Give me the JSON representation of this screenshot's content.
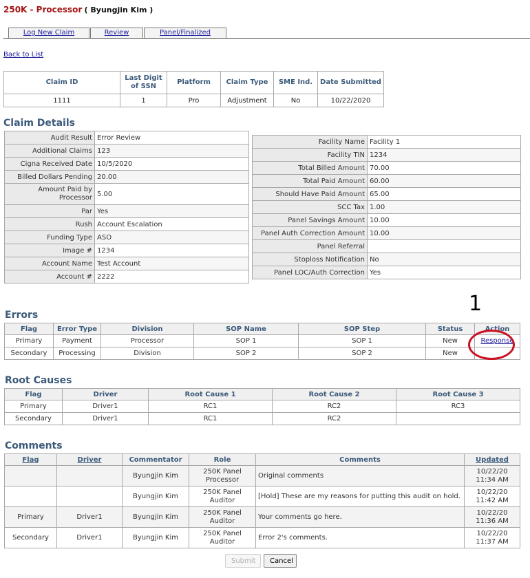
{
  "header": {
    "title": "250K - Processor",
    "user": "( Byungjin Kim )"
  },
  "tabs": [
    "Log New Claim",
    "Review",
    "Panel/Finalized"
  ],
  "back_link": "Back to List",
  "summary": {
    "headers": [
      "Claim ID",
      "Last Digit of SSN",
      "Platform",
      "Claim Type",
      "SME Ind.",
      "Date Submitted"
    ],
    "values": [
      "1111",
      "1",
      "Pro",
      "Adjustment",
      "No",
      "10/22/2020"
    ]
  },
  "claim_details": {
    "title": "Claim Details",
    "left": [
      {
        "label": "Audit Result",
        "value": "Error Review"
      },
      {
        "label": "Additional Claims",
        "value": "123"
      },
      {
        "label": "Cigna Received Date",
        "value": "10/5/2020"
      },
      {
        "label": "Billed Dollars Pending",
        "value": "20.00"
      },
      {
        "label": "Amount Paid by Processor",
        "value": "5.00"
      },
      {
        "label": "Par",
        "value": "Yes"
      },
      {
        "label": "Rush",
        "value": "Account Escalation"
      },
      {
        "label": "Funding Type",
        "value": "ASO"
      },
      {
        "label": "Image #",
        "value": "1234"
      },
      {
        "label": "Account Name",
        "value": "Test Account"
      },
      {
        "label": "Account #",
        "value": "2222"
      }
    ],
    "right": [
      {
        "label": "Facility Name",
        "value": "Facility 1"
      },
      {
        "label": "Facility TIN",
        "value": "1234"
      },
      {
        "label": "Total Billed Amount",
        "value": "70.00"
      },
      {
        "label": "Total Paid Amount",
        "value": "60.00"
      },
      {
        "label": "Should Have Paid Amount",
        "value": "65.00"
      },
      {
        "label": "SCC Tax",
        "value": "1.00"
      },
      {
        "label": "Panel Savings Amount",
        "value": "10.00"
      },
      {
        "label": "Panel Auth Correction Amount",
        "value": "10.00"
      },
      {
        "label": "Panel Referral",
        "value": ""
      },
      {
        "label": "Stoploss Notification",
        "value": "No"
      },
      {
        "label": "Panel LOC/Auth Correction",
        "value": "Yes"
      }
    ]
  },
  "errors": {
    "title": "Errors",
    "headers": [
      "Flag",
      "Error Type",
      "Division",
      "SOP Name",
      "SOP Step",
      "Status",
      "Action"
    ],
    "rows": [
      {
        "flag": "Primary",
        "error_type": "Payment",
        "division": "Processor",
        "sop_name": "SOP 1",
        "sop_step": "SOP 1",
        "status": "New",
        "action": "Response"
      },
      {
        "flag": "Secondary",
        "error_type": "Processing",
        "division": "Division",
        "sop_name": "SOP 2",
        "sop_step": "SOP 2",
        "status": "New",
        "action": ""
      }
    ]
  },
  "root_causes": {
    "title": "Root Causes",
    "headers": [
      "Flag",
      "Driver",
      "Root Cause 1",
      "Root Cause 2",
      "Root Cause 3"
    ],
    "rows": [
      [
        "Primary",
        "Driver1",
        "RC1",
        "RC2",
        "RC3"
      ],
      [
        "Secondary",
        "Driver1",
        "RC1",
        "RC2",
        ""
      ]
    ]
  },
  "comments": {
    "title": "Comments",
    "headers": [
      "Flag",
      "Driver",
      "Commentator",
      "Role",
      "Comments",
      "Updated"
    ],
    "rows": [
      {
        "flag": "",
        "driver": "",
        "commentator": "Byungjin Kim",
        "role": "250K Panel Processor",
        "comment": "Original comments",
        "updated": "10/22/20 11:34 AM"
      },
      {
        "flag": "",
        "driver": "",
        "commentator": "Byungjin Kim",
        "role": "250K Panel Auditor",
        "comment": "[Hold] These are my reasons for putting this audit on hold.",
        "updated": "10/22/20 11:42 AM"
      },
      {
        "flag": "Primary",
        "driver": "Driver1",
        "commentator": "Byungjin Kim",
        "role": "250K Panel Auditor",
        "comment": "Your comments go here.",
        "updated": "10/22/20 11:36 AM"
      },
      {
        "flag": "Secondary",
        "driver": "Driver1",
        "commentator": "Byungjin Kim",
        "role": "250K Panel Auditor",
        "comment": "Error 2's comments.",
        "updated": "10/22/20 11:37 AM"
      }
    ]
  },
  "annotation": {
    "number": "1"
  },
  "buttons": {
    "submit": "Submit",
    "cancel": "Cancel"
  },
  "colors": {
    "title_red": "#a31515",
    "heading_blue": "#3b5a7a",
    "link_blue": "#1a1a9a",
    "annotation_red": "#cc1122"
  }
}
